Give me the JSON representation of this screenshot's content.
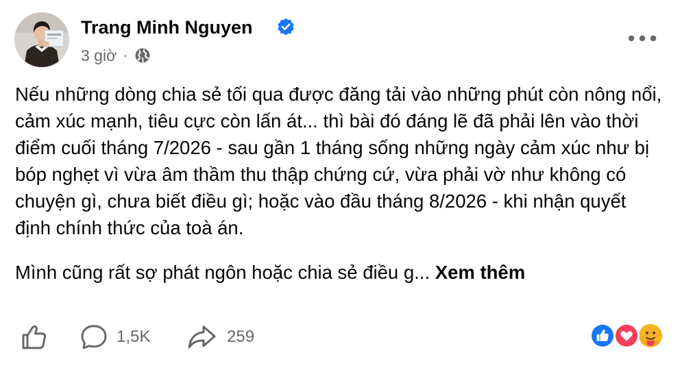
{
  "post": {
    "author": "Trang Minh Nguyen",
    "verified": true,
    "timestamp": "3 giờ",
    "separator": "·",
    "privacy_icon": "globe-icon",
    "more_icon": "more-horizontal-icon",
    "body_paragraph_1": "Nếu những dòng chia sẻ tối qua được đăng tải vào những phút còn nông nổi, cảm xúc mạnh, tiêu cực còn lấn át... thì bài đó đáng lẽ đã phải lên vào thời điểm cuối tháng 7/2026 - sau gần 1 tháng sống những ngày cảm xúc như bị bóp nghẹt vì vừa âm thầm thu thập chứng cứ, vừa phải vờ như không có chuyện gì, chưa biết điều gì; hoặc vào đầu tháng 8/2026 - khi nhận quyết định chính thức của toà án.",
    "body_paragraph_2": "Mình cũng rất sợ phát ngôn hoặc chia sẻ điều g...",
    "see_more": "Xem thêm"
  },
  "actions": {
    "like_icon": "thumbs-up-icon",
    "comment_icon": "comment-bubble-icon",
    "comment_count": "1,5K",
    "share_icon": "share-arrow-icon",
    "share_count": "259"
  },
  "reactions": [
    "like-reaction-icon",
    "love-reaction-icon",
    "care-reaction-icon"
  ],
  "colors": {
    "text": "#050505",
    "secondary": "#65676b",
    "verified_blue": "#1877f2",
    "love_red": "#f33e58",
    "care_yellow": "#f7b125"
  }
}
